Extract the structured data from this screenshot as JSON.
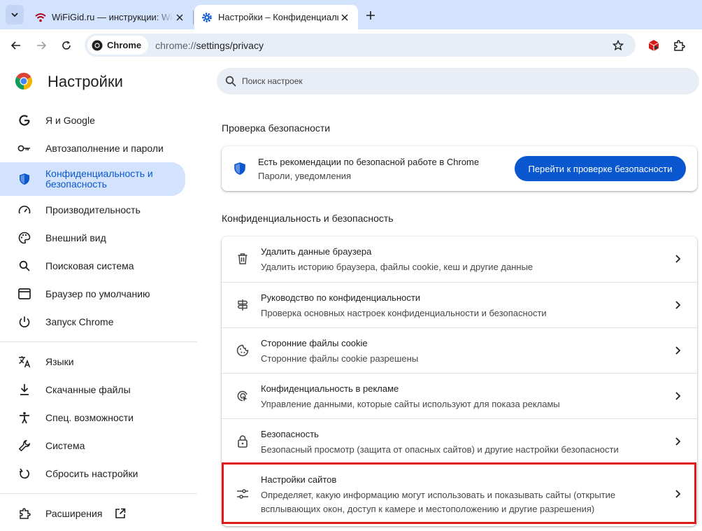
{
  "tabs": [
    {
      "title": "WiFiGid.ru — инструкции: Wi-Fi, роутеры, компьютеры"
    },
    {
      "title": "Настройки – Конфиденциальность и безопасность"
    }
  ],
  "toolbar": {
    "chip_label": "Chrome",
    "url_scheme": "chrome://",
    "url_path": "settings/privacy"
  },
  "sidebar": {
    "title": "Настройки",
    "items": [
      {
        "label": "Я и Google",
        "icon": "google-g-icon"
      },
      {
        "label": "Автозаполнение и пароли",
        "icon": "key-icon"
      },
      {
        "label": "Конфиденциальность и безопасность",
        "icon": "shield-icon",
        "active": true
      },
      {
        "label": "Производительность",
        "icon": "speedometer-icon"
      },
      {
        "label": "Внешний вид",
        "icon": "palette-icon"
      },
      {
        "label": "Поисковая система",
        "icon": "search-icon"
      },
      {
        "label": "Браузер по умолчанию",
        "icon": "browser-window-icon"
      },
      {
        "label": "Запуск Chrome",
        "icon": "power-icon"
      },
      {
        "label": "Языки",
        "icon": "translate-icon"
      },
      {
        "label": "Скачанные файлы",
        "icon": "download-icon"
      },
      {
        "label": "Спец. возможности",
        "icon": "accessibility-icon"
      },
      {
        "label": "Система",
        "icon": "wrench-icon"
      },
      {
        "label": "Сбросить настройки",
        "icon": "reset-icon"
      },
      {
        "label": "Расширения",
        "icon": "puzzle-icon"
      }
    ]
  },
  "search": {
    "placeholder": "Поиск настроек"
  },
  "safety_check": {
    "section_title": "Проверка безопасности",
    "title": "Есть рекомендации по безопасной работе в Chrome",
    "subtitle": "Пароли, уведомления",
    "button": "Перейти к проверке безопасности"
  },
  "privacy": {
    "section_title": "Конфиденциальность и безопасность",
    "rows": [
      {
        "title": "Удалить данные браузера",
        "subtitle": "Удалить историю браузера, файлы cookie, кеш и другие данные",
        "icon": "trash-icon"
      },
      {
        "title": "Руководство по конфиденциальности",
        "subtitle": "Проверка основных настроек конфиденциальности и безопасности",
        "icon": "signpost-icon"
      },
      {
        "title": "Сторонние файлы cookie",
        "subtitle": "Сторонние файлы cookie разрешены",
        "icon": "cookie-icon"
      },
      {
        "title": "Конфиденциальность в рекламе",
        "subtitle": "Управление данными, которые сайты используют для показа рекламы",
        "icon": "ad-privacy-icon"
      },
      {
        "title": "Безопасность",
        "subtitle": "Безопасный просмотр (защита от опасных сайтов) и другие настройки безопасности",
        "icon": "lock-icon"
      },
      {
        "title": "Настройки сайтов",
        "subtitle": "Определяет, какую информацию могут использовать и показывать сайты (открытие всплывающих окон, доступ к камере и местоположению и другие разрешения)",
        "icon": "tune-icon"
      }
    ]
  },
  "colors": {
    "accent": "#0b57d0",
    "highlight": "#e01a1a",
    "active_bg": "#d3e3fd"
  }
}
